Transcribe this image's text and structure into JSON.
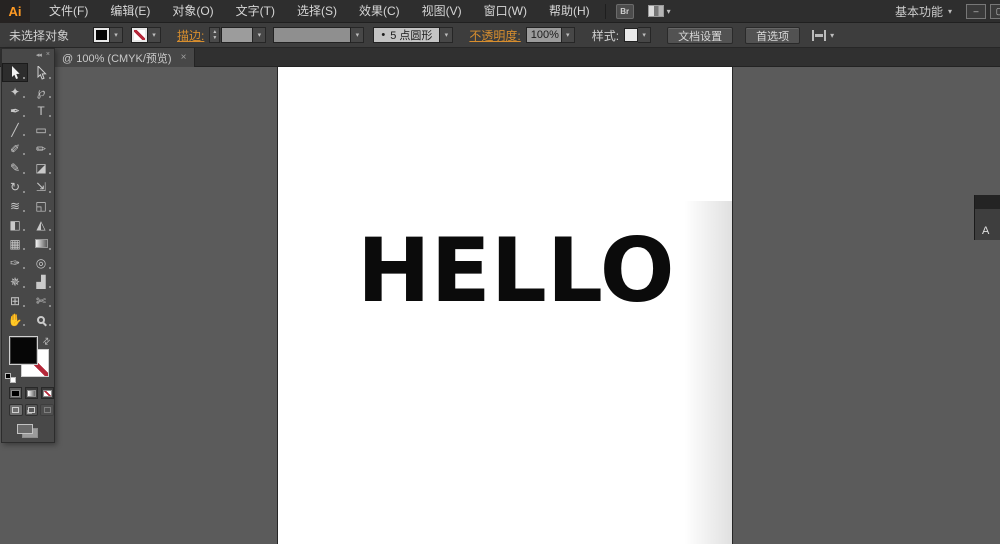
{
  "colors": {
    "accent_orange": "#d78e2e",
    "pasteboard_gray": "#5b5b5b",
    "artboard_white": "#ffffff",
    "ui_dark": "#2e2e2e",
    "text_black": "#0b0b0b"
  },
  "icons": {
    "caret_down": "▾",
    "stepper_up": "▲",
    "stepper_down": "▼",
    "close": "×",
    "collapse": "◂◂",
    "swap": "⇄",
    "minimize": "–",
    "maximize": "▢",
    "bullet": "•"
  },
  "menu_bar": {
    "logo": "Ai",
    "items": [
      "文件(F)",
      "编辑(E)",
      "对象(O)",
      "文字(T)",
      "选择(S)",
      "效果(C)",
      "视图(V)",
      "窗口(W)",
      "帮助(H)"
    ],
    "bridge_label": "Br",
    "workspace": "基本功能"
  },
  "control_bar": {
    "status": "未选择对象",
    "stroke_label": "描边:",
    "brush_name": "5 点圆形",
    "opacity_label": "不透明度:",
    "opacity_value": "100%",
    "style_label": "样式:",
    "document_setup": "文档设置",
    "preferences": "首选项"
  },
  "document_tab": {
    "title": "@ 100% (CMYK/预览)"
  },
  "tools_panel": {
    "tools": [
      {
        "name": "selection-tool",
        "render": "cursor-filled",
        "selected": true
      },
      {
        "name": "direct-selection-tool",
        "render": "cursor-outline"
      },
      {
        "name": "magic-wand-tool",
        "glyph": "✦"
      },
      {
        "name": "lasso-tool",
        "glyph": "℘"
      },
      {
        "name": "pen-tool",
        "glyph": "✒"
      },
      {
        "name": "type-tool",
        "glyph": "T"
      },
      {
        "name": "line-segment-tool",
        "glyph": "╱"
      },
      {
        "name": "rectangle-tool",
        "glyph": "▭"
      },
      {
        "name": "paintbrush-tool",
        "glyph": "✐"
      },
      {
        "name": "pencil-tool",
        "glyph": "✏"
      },
      {
        "name": "blob-brush-tool",
        "glyph": "✎"
      },
      {
        "name": "eraser-tool",
        "glyph": "◪"
      },
      {
        "name": "rotate-tool",
        "glyph": "↻"
      },
      {
        "name": "scale-tool",
        "glyph": "⇲"
      },
      {
        "name": "width-tool",
        "glyph": "≋"
      },
      {
        "name": "free-transform-tool",
        "glyph": "◱"
      },
      {
        "name": "shape-builder-tool",
        "glyph": "◧"
      },
      {
        "name": "perspective-grid-tool",
        "glyph": "◭"
      },
      {
        "name": "mesh-tool",
        "glyph": "▦"
      },
      {
        "name": "gradient-tool",
        "render": "gradient"
      },
      {
        "name": "eyedropper-tool",
        "glyph": "✑"
      },
      {
        "name": "blend-tool",
        "glyph": "◎"
      },
      {
        "name": "symbol-sprayer-tool",
        "glyph": "✵"
      },
      {
        "name": "column-graph-tool",
        "glyph": "▟"
      },
      {
        "name": "artboard-tool",
        "glyph": "⊞"
      },
      {
        "name": "slice-tool",
        "glyph": "✄"
      },
      {
        "name": "hand-tool",
        "glyph": "✋"
      },
      {
        "name": "zoom-tool",
        "render": "magnifier"
      }
    ]
  },
  "canvas": {
    "text": "HELLO"
  },
  "right_dock": {
    "label": "A"
  }
}
